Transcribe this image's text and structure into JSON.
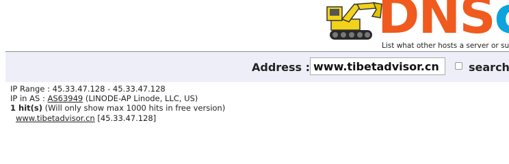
{
  "logo": {
    "text_main": "DNS",
    "text_accent": "c",
    "tagline": "List what other hosts a server or su"
  },
  "search": {
    "address_label": "Address :",
    "address_value": "www.tibetadvisor.cn",
    "search_label": "search",
    "search_checked": false
  },
  "results": {
    "ip_range_label": "IP Range :",
    "ip_range_value": "45.33.47.128 - 45.33.47.128",
    "ip_as_label": "IP in AS :",
    "asn_link": "AS63949",
    "asn_description": "(LINODE-AP Linode, LLC, US)",
    "hits_count": "1 hit(s)",
    "hits_note": "(Will only show max 1000 hits in free version)",
    "hosts": [
      {
        "host": "www.tibetadvisor.cn",
        "ip": "[45.33.47.128]"
      }
    ]
  },
  "colors": {
    "logo_orange": "#f05a1e",
    "logo_blue": "#0da3dd",
    "excavator_yellow": "#f2d21a",
    "bar_background": "#eeeef8"
  }
}
